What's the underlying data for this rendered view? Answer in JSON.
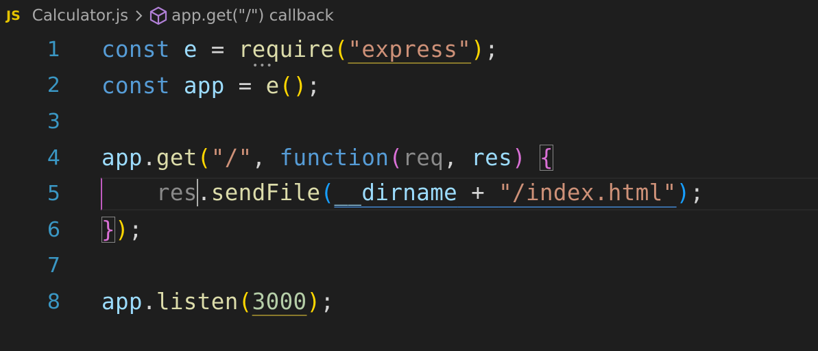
{
  "breadcrumb": {
    "file_badge": "JS",
    "file_name": "Calculator.js",
    "symbol_icon": "cube-icon",
    "symbol_name": "app.get(\"/\") callback"
  },
  "editor": {
    "line_numbers": [
      "1",
      "2",
      "3",
      "4",
      "5",
      "6",
      "7",
      "8"
    ],
    "lines": [
      [
        "const",
        " ",
        "e",
        " = ",
        "require",
        "(",
        "\"express\"",
        ")",
        ";"
      ],
      [
        "const",
        " ",
        "app",
        " = ",
        "e",
        "(",
        ")",
        ";"
      ],
      [],
      [
        "app",
        ".",
        "get",
        "(",
        "\"/\"",
        ", ",
        "function",
        "(",
        "req",
        ", ",
        "res",
        ")",
        " ",
        "{"
      ],
      [
        "    ",
        "res",
        ".",
        "sendFile",
        "(",
        "__dirname",
        " + ",
        "\"/index.html\"",
        ")",
        ";"
      ],
      [
        "}",
        ")",
        ";"
      ],
      [],
      [
        "app",
        ".",
        "listen",
        "(",
        "3000",
        ")",
        ";"
      ]
    ]
  },
  "colors": {
    "background": "#1e1e1e",
    "keyword": "#569cd6",
    "variable": "#9cdcfe",
    "function": "#dcdcaa",
    "string": "#ce9178",
    "number": "#b5cea8",
    "bracket_level1": "#ffd700",
    "bracket_level2": "#da70d6",
    "bracket_level3": "#179fff",
    "line_number": "#3a97c4",
    "js_badge": "#e5c400"
  }
}
